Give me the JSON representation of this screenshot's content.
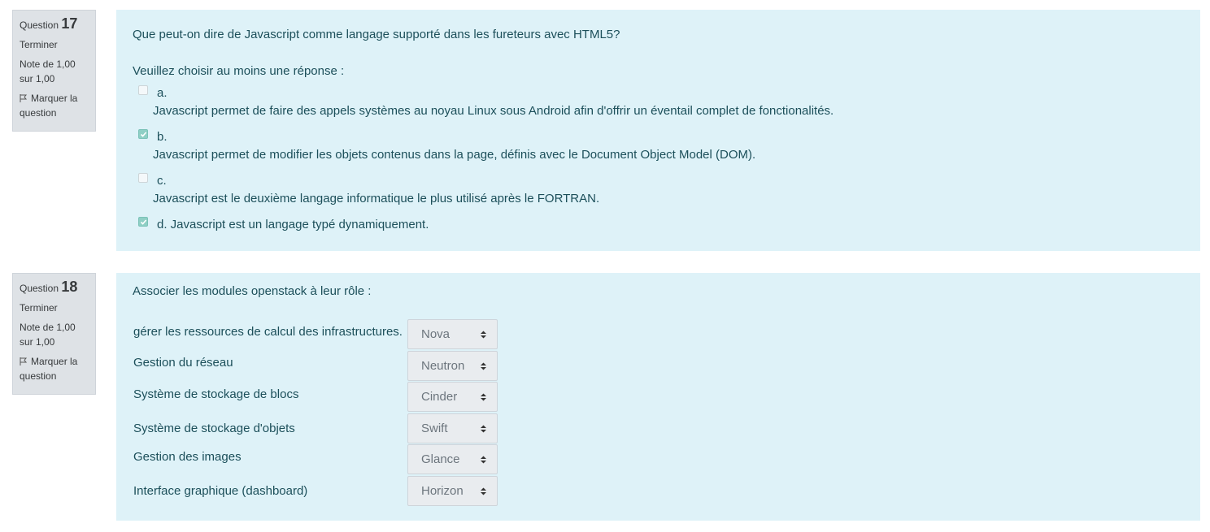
{
  "q17": {
    "label": "Question",
    "number": "17",
    "state": "Terminer",
    "grade_line1": "Note de 1,00",
    "grade_line2": "sur 1,00",
    "flag_line1": "Marquer la",
    "flag_line2": "question",
    "text": "Que peut-on dire de Javascript comme langage supporté dans les fureteurs avec HTML5?",
    "prompt": "Veuillez choisir au moins une réponse :",
    "options": [
      {
        "letter": "a.",
        "text": "Javascript permet de faire des appels systèmes au noyau Linux sous Android afin d'offrir un éventail complet de fonctionalités.",
        "checked": false
      },
      {
        "letter": "b.",
        "text": "Javascript permet de modifier les objets contenus dans la page, définis avec le Document Object Model (DOM).",
        "checked": true
      },
      {
        "letter": "c.",
        "text": "Javascript est le deuxième langage informatique le plus utilisé après le FORTRAN.",
        "checked": false
      },
      {
        "letter": "d. Javascript est un langage typé dynamiquement.",
        "checked": true
      }
    ]
  },
  "q18": {
    "label": "Question",
    "number": "18",
    "state": "Terminer",
    "grade_line1": "Note de 1,00",
    "grade_line2": "sur 1,00",
    "flag_line1": "Marquer la",
    "flag_line2": "question",
    "text": "Associer les modules openstack à leur rôle :",
    "rows": [
      {
        "label": "gérer les ressources de calcul des infrastructures.",
        "value": "Nova"
      },
      {
        "label": "Gestion du réseau",
        "value": "Neutron"
      },
      {
        "label": "Système de stockage de blocs",
        "value": "Cinder"
      },
      {
        "label": "Système de stockage d'objets",
        "value": "Swift"
      },
      {
        "label": "Gestion des images",
        "value": "Glance"
      },
      {
        "label": "Interface graphique (dashboard)",
        "value": "Horizon"
      }
    ]
  }
}
